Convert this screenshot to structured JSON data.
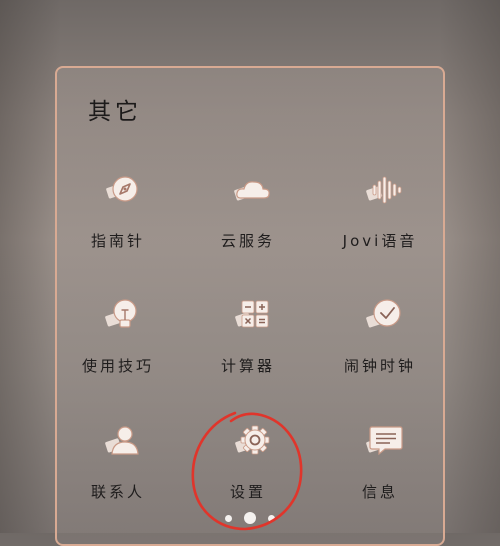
{
  "folder": {
    "title": "其它"
  },
  "apps": [
    {
      "label": "指南针",
      "icon": "compass-icon"
    },
    {
      "label": "云服务",
      "icon": "cloud-icon"
    },
    {
      "label": "Jovi语音",
      "icon": "voice-wave-icon"
    },
    {
      "label": "使用技巧",
      "icon": "lightbulb-icon"
    },
    {
      "label": "计算器",
      "icon": "calculator-icon"
    },
    {
      "label": "闹钟时钟",
      "icon": "clock-icon"
    },
    {
      "label": "联系人",
      "icon": "contact-person-icon"
    },
    {
      "label": "设置",
      "icon": "settings-gear-icon"
    },
    {
      "label": "信息",
      "icon": "message-icon"
    }
  ],
  "pagination": {
    "count": 3,
    "active": 2
  },
  "colors": {
    "icon_fill": "#f6eee9",
    "icon_stroke": "#c99a87",
    "panel_border": "#d8aa93",
    "annotation": "#e0352b"
  }
}
